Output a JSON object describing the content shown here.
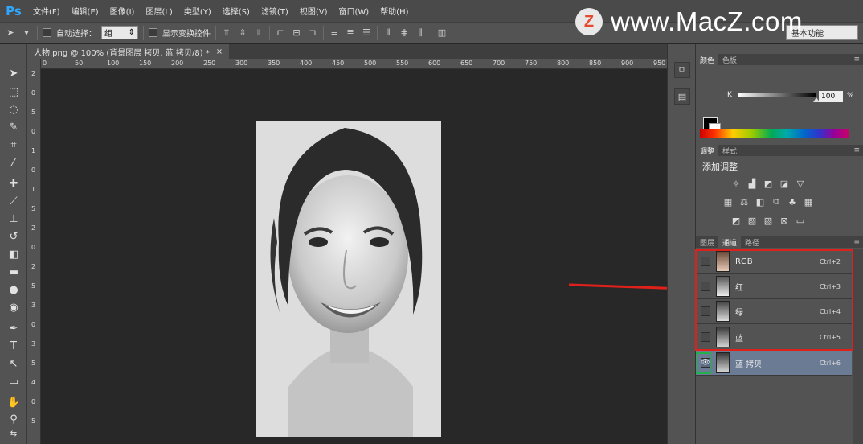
{
  "app": {
    "logo": "Ps"
  },
  "menu": [
    "文件(F)",
    "编辑(E)",
    "图像(I)",
    "图层(L)",
    "类型(Y)",
    "选择(S)",
    "滤镜(T)",
    "视图(V)",
    "窗口(W)",
    "帮助(H)"
  ],
  "options": {
    "auto_select_label": "自动选择：",
    "auto_select_value": "组",
    "show_transform_label": "显示变换控件",
    "workspace": "基本功能"
  },
  "watermark": {
    "logo": "Z",
    "text": "www.MacZ.com"
  },
  "document": {
    "tab_label": "人物.png @ 100% (背景图层 拷贝, 蓝 拷贝/8) *",
    "close": "×"
  },
  "rulers": {
    "h": [
      "0",
      "50",
      "100",
      "150",
      "200",
      "250",
      "300",
      "350",
      "400",
      "450",
      "500",
      "550",
      "600",
      "650",
      "700",
      "750",
      "800",
      "850",
      "900",
      "950"
    ],
    "v": [
      "2",
      "0",
      "5",
      "0",
      "1",
      "0",
      "1",
      "5",
      "2",
      "0",
      "2",
      "5",
      "3",
      "0",
      "3",
      "5",
      "4",
      "0",
      "5"
    ]
  },
  "panels": {
    "color": {
      "tabs": [
        "颜色",
        "色板"
      ],
      "channel_label": "K",
      "value": "100",
      "unit": "%"
    },
    "adjust": {
      "tabs": [
        "调整",
        "样式"
      ],
      "title": "添加调整"
    },
    "layers": {
      "tabs": [
        "图层",
        "通道",
        "路径"
      ]
    },
    "channels": [
      {
        "name": "RGB",
        "shortcut": "Ctrl+2",
        "visible": false,
        "selected": false
      },
      {
        "name": "红",
        "shortcut": "Ctrl+3",
        "visible": false,
        "selected": false
      },
      {
        "name": "绿",
        "shortcut": "Ctrl+4",
        "visible": false,
        "selected": false
      },
      {
        "name": "蓝",
        "shortcut": "Ctrl+5",
        "visible": false,
        "selected": false
      },
      {
        "name": "蓝 拷贝",
        "shortcut": "Ctrl+6",
        "visible": true,
        "selected": true
      }
    ]
  },
  "colors": {
    "annotation_red": "#e0201a",
    "annotation_green": "#23b14d",
    "selected_row": "#6b7b93"
  }
}
